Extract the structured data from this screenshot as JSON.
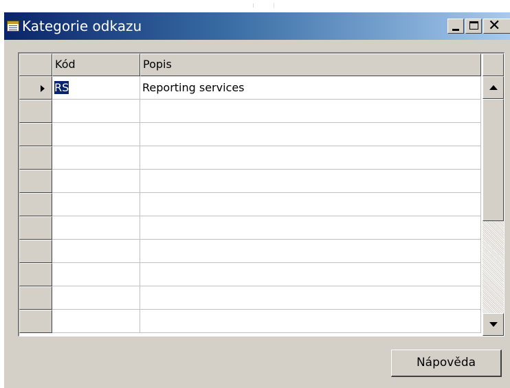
{
  "window": {
    "title": "Kategorie odkazu",
    "icon": "table-icon",
    "controls": {
      "minimize": "minimize-icon",
      "maximize": "maximize-icon",
      "close": "close-icon"
    }
  },
  "table": {
    "columns": [
      "Kód",
      "Popis"
    ],
    "rows": [
      {
        "kod": "RS",
        "popis": "Reporting services",
        "current": true
      },
      {
        "kod": "",
        "popis": ""
      },
      {
        "kod": "",
        "popis": ""
      },
      {
        "kod": "",
        "popis": ""
      },
      {
        "kod": "",
        "popis": ""
      },
      {
        "kod": "",
        "popis": ""
      },
      {
        "kod": "",
        "popis": ""
      },
      {
        "kod": "",
        "popis": ""
      },
      {
        "kod": "",
        "popis": ""
      },
      {
        "kod": "",
        "popis": ""
      },
      {
        "kod": "",
        "popis": ""
      }
    ]
  },
  "buttons": {
    "help": "Nápověda"
  },
  "colors": {
    "title_gradient_start": "#0a246a",
    "title_gradient_end": "#a6caf0",
    "face": "#d4d0c8",
    "selection": "#0a246a"
  }
}
